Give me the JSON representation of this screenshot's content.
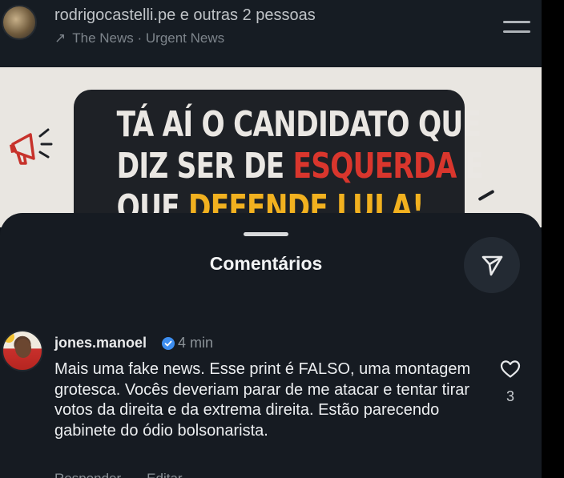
{
  "post": {
    "author_line": "rodrigocastelli.pe e outras 2 pessoas",
    "source_arrow": "↗",
    "source": "The News · Urgent News",
    "menu_icon": "menu-icon"
  },
  "image": {
    "line1": "TÁ AÍ O CANDIDATO QUE",
    "line2_a": "DIZ SER DE ",
    "line2_red": "ESQUERDA",
    "line2_b": " E",
    "line3_a": "QUE ",
    "line3_yellow": "DEFENDE LULA!",
    "colors": {
      "red": "#d9362d",
      "yellow": "#f2b11f",
      "box": "#1e2126"
    }
  },
  "sheet": {
    "title": "Comentários",
    "send_icon": "send-icon"
  },
  "comment": {
    "username": "jones.manoel",
    "verified_icon": "verified-badge-icon",
    "time": "4 min",
    "text": "Mais uma fake news. Esse print é FALSO, uma montagem grotesca. Vocês deveriam parar de me atacar e tentar tirar votos da direita e da extrema direita. Estão parecendo gabinete do ódio bolsonarista.",
    "likes": "3",
    "reply_label": "Responder",
    "edit_label": "Editar"
  }
}
